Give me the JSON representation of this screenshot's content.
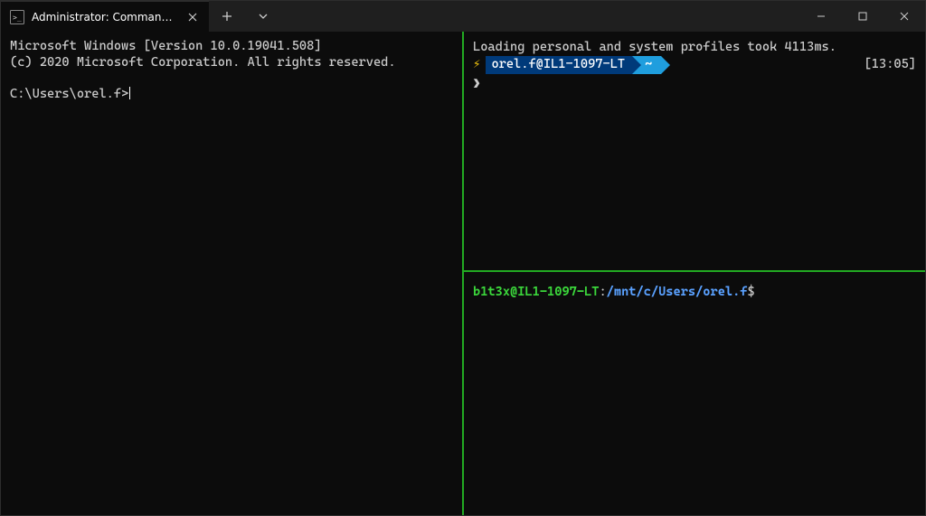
{
  "titlebar": {
    "tab": {
      "title": "Administrator: Command Prompt"
    }
  },
  "cmd_pane": {
    "line1": "Microsoft Windows [Version 10.0.19041.508]",
    "line2": "(c) 2020 Microsoft Corporation. All rights reserved.",
    "prompt": "C:\\Users\\orel.f>"
  },
  "ps_pane": {
    "loading": "Loading personal and system profiles took 4113ms.",
    "lightning": "⚡",
    "user_host": "orel.f@IL1-1097-LT",
    "tilde": "~",
    "time": "[13:05]",
    "caret": "❯"
  },
  "wsl_pane": {
    "user_host": "b1t3x@IL1-1097-LT",
    "colon": ":",
    "path": "/mnt/c/Users/orel.f",
    "dollar": "$"
  }
}
